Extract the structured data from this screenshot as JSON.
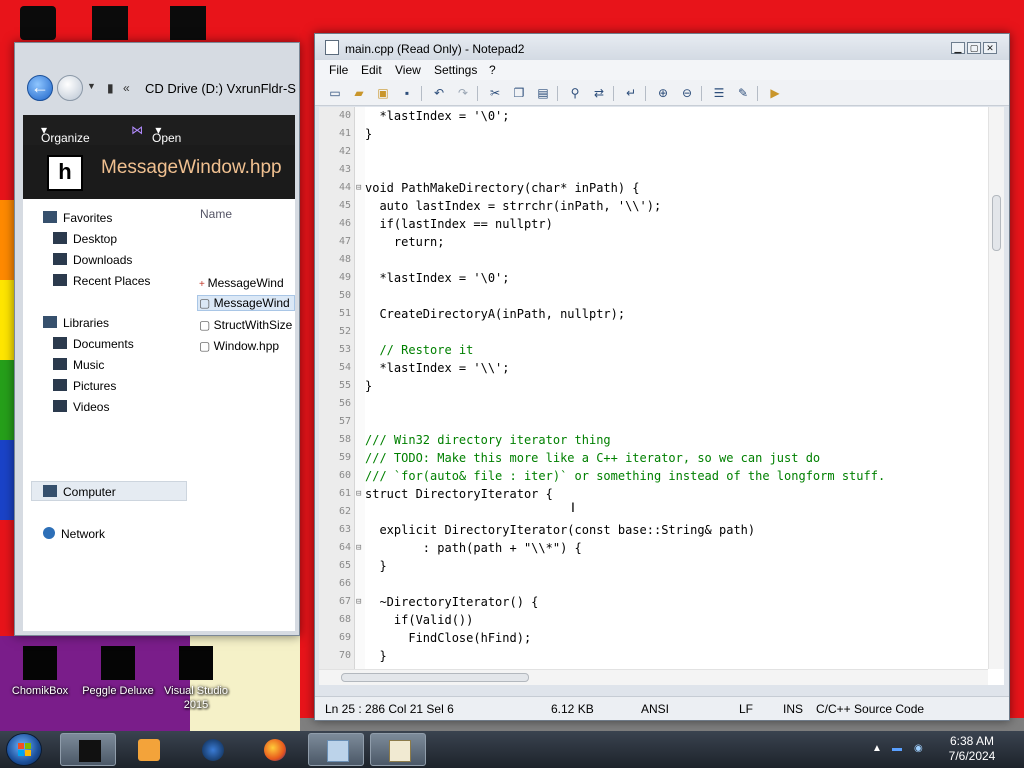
{
  "desktop": {
    "icons": [
      {
        "label": "ChomikBox"
      },
      {
        "label": "Peggle Deluxe"
      },
      {
        "label": "Visual Studio 2015"
      }
    ]
  },
  "explorer": {
    "address": "CD Drive (D:) VxrunFldr-S",
    "toolbar": {
      "organize": "Organize",
      "open": "Open"
    },
    "header_title": "MessageWindow.hpp",
    "column_name": "Name",
    "nav": {
      "favorites": "Favorites",
      "desktop": "Desktop",
      "downloads": "Downloads",
      "recent": "Recent Places",
      "libraries": "Libraries",
      "documents": "Documents",
      "music": "Music",
      "pictures": "Pictures",
      "videos": "Videos",
      "computer": "Computer",
      "network": "Network"
    },
    "files": [
      "MessageWind",
      "MessageWind",
      "StructWithSize",
      "Window.hpp"
    ]
  },
  "notepad": {
    "title": "main.cpp (Read Only) - Notepad2",
    "menu": [
      "File",
      "Edit",
      "View",
      "Settings",
      "?"
    ],
    "lines": [
      {
        "n": "40",
        "fold": "",
        "code": "  *lastIndex = '\\0';"
      },
      {
        "n": "41",
        "fold": "",
        "code": "}"
      },
      {
        "n": "42",
        "fold": "",
        "code": ""
      },
      {
        "n": "43",
        "fold": "",
        "code": ""
      },
      {
        "n": "44",
        "fold": "⊟",
        "code": "void PathMakeDirectory(char* inPath) {"
      },
      {
        "n": "45",
        "fold": "",
        "code": "  auto lastIndex = strrchr(inPath, '\\\\');"
      },
      {
        "n": "46",
        "fold": "",
        "code": "  if(lastIndex == nullptr)"
      },
      {
        "n": "47",
        "fold": "",
        "code": "    return;"
      },
      {
        "n": "48",
        "fold": "",
        "code": ""
      },
      {
        "n": "49",
        "fold": "",
        "code": "  *lastIndex = '\\0';"
      },
      {
        "n": "50",
        "fold": "",
        "code": ""
      },
      {
        "n": "51",
        "fold": "",
        "code": "  CreateDirectoryA(inPath, nullptr);"
      },
      {
        "n": "52",
        "fold": "",
        "code": ""
      },
      {
        "n": "53",
        "fold": "",
        "code": "  // Restore it"
      },
      {
        "n": "54",
        "fold": "",
        "code": "  *lastIndex = '\\\\';"
      },
      {
        "n": "55",
        "fold": "",
        "code": "}"
      },
      {
        "n": "56",
        "fold": "",
        "code": ""
      },
      {
        "n": "57",
        "fold": "",
        "code": ""
      },
      {
        "n": "58",
        "fold": "",
        "code": "/// Win32 directory iterator thing"
      },
      {
        "n": "59",
        "fold": "",
        "code": "/// TODO: Make this more like a C++ iterator, so we can just do"
      },
      {
        "n": "60",
        "fold": "",
        "code": "/// `for(auto& file : iter)` or something instead of the longform stuff."
      },
      {
        "n": "61",
        "fold": "⊟",
        "code": "struct DirectoryIterator {"
      },
      {
        "n": "62",
        "fold": "",
        "code": ""
      },
      {
        "n": "63",
        "fold": "",
        "code": "  explicit DirectoryIterator(const base::String& path)"
      },
      {
        "n": "64",
        "fold": "⊟",
        "code": "        : path(path + \"\\\\*\") {"
      },
      {
        "n": "65",
        "fold": "",
        "code": "  }"
      },
      {
        "n": "66",
        "fold": "",
        "code": ""
      },
      {
        "n": "67",
        "fold": "⊟",
        "code": "  ~DirectoryIterator() {"
      },
      {
        "n": "68",
        "fold": "",
        "code": "    if(Valid())"
      },
      {
        "n": "69",
        "fold": "",
        "code": "      FindClose(hFind);"
      },
      {
        "n": "70",
        "fold": "",
        "code": "  }"
      },
      {
        "n": "71",
        "fold": "",
        "code": ""
      }
    ],
    "status": {
      "pos": "Ln 25 : 286   Col 21   Sel 6",
      "size": "6.12 KB",
      "encoding": "ANSI",
      "eol": "LF",
      "mode": "INS",
      "lang": "C/C++ Source Code"
    }
  },
  "taskbar": {
    "time": "6:38 AM",
    "date": "7/6/2024"
  },
  "colors": {
    "comment": "#008000",
    "keyword": "#0000ff",
    "string": "#008000",
    "wallpaper": "#e8141a"
  }
}
